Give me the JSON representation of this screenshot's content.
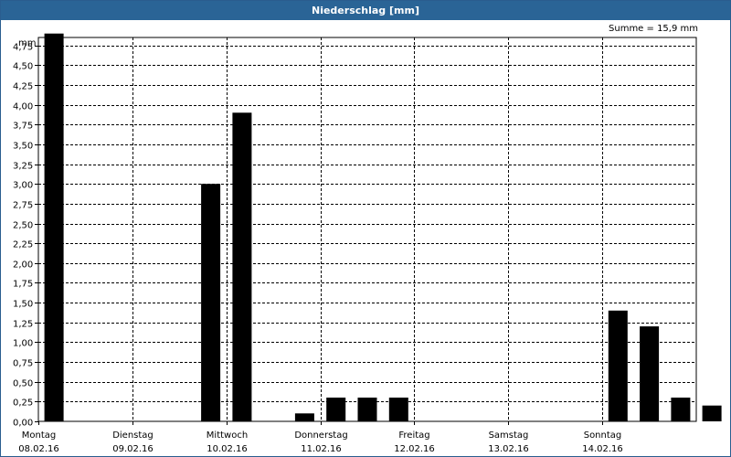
{
  "window": {
    "title": "Niederschlag [mm]"
  },
  "summary": {
    "text": "Summe = 15,9 mm"
  },
  "chart_data": {
    "type": "bar",
    "title": "Niederschlag [mm]",
    "ylabel": "mm",
    "xlabel": "",
    "ylim": [
      0,
      4.85
    ],
    "yticks": [
      "0,00",
      "0,25",
      "0,50",
      "0,75",
      "1,00",
      "1,25",
      "1,50",
      "1,75",
      "2,00",
      "2,25",
      "2,50",
      "2,75",
      "3,00",
      "3,25",
      "3,50",
      "3,75",
      "4,00",
      "4,25",
      "4,50",
      "4,75"
    ],
    "ytick_values": [
      0,
      0.25,
      0.5,
      0.75,
      1.0,
      1.25,
      1.5,
      1.75,
      2.0,
      2.25,
      2.5,
      2.75,
      3.0,
      3.25,
      3.5,
      3.75,
      4.0,
      4.25,
      4.5,
      4.75
    ],
    "days": [
      {
        "name": "Montag",
        "date": "08.02.16"
      },
      {
        "name": "Dienstag",
        "date": "09.02.16"
      },
      {
        "name": "Mittwoch",
        "date": "10.02.16"
      },
      {
        "name": "Donnerstag",
        "date": "11.02.16"
      },
      {
        "name": "Freitag",
        "date": "12.02.16"
      },
      {
        "name": "Samstag",
        "date": "13.02.16"
      },
      {
        "name": "Sonntag",
        "date": "14.02.16"
      }
    ],
    "interval_hours": 8,
    "values": [
      4.9,
      0,
      0,
      0,
      0,
      3.0,
      3.9,
      0,
      0.1,
      0.3,
      0.3,
      0.3,
      0,
      0,
      0,
      0,
      0,
      0,
      1.4,
      1.2,
      0.3,
      0.2
    ],
    "grid": true,
    "bar_color": "#000000",
    "grid_color": "#000000"
  }
}
